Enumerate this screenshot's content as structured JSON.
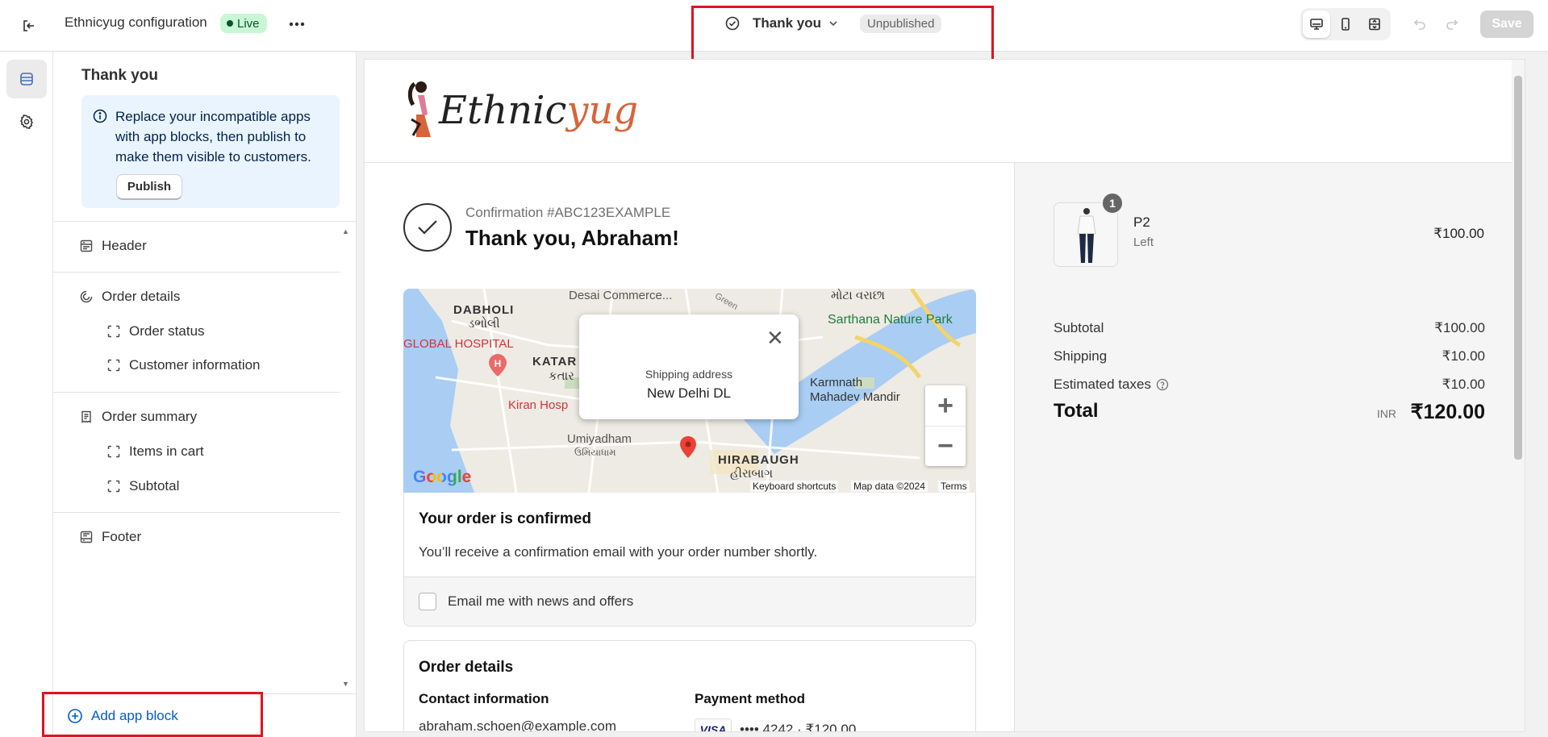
{
  "topbar": {
    "store_title": "Ethnicyug configuration",
    "live_label": "Live",
    "template_name": "Thank you",
    "template_status": "Unpublished",
    "save_label": "Save"
  },
  "sidebar": {
    "title": "Thank you",
    "banner_text": "Replace your incompatible apps with app blocks, then publish to make them visible to customers.",
    "publish_label": "Publish",
    "sections": {
      "header": "Header",
      "order_details": "Order details",
      "order_status": "Order status",
      "customer_information": "Customer information",
      "order_summary": "Order summary",
      "items_in_cart": "Items in cart",
      "subtotal": "Subtotal",
      "footer": "Footer"
    },
    "add_app_block_label": "Add app block"
  },
  "preview": {
    "logo_main": "Ethnic",
    "logo_accent": "yug",
    "confirmation_number": "Confirmation #ABC123EXAMPLE",
    "thank_you": "Thank you, Abraham!",
    "map": {
      "tooltip_label": "Shipping address",
      "tooltip_value": "New Delhi DL",
      "labels": [
        "Desai Commerce...",
        "DABHOLI",
        "ડભોલી",
        "GLOBAL HOSPITAL",
        "KATAR",
        "કતાર",
        "Kiran Hosp",
        "મોટા વરાછા",
        "Sarthana Nature Park",
        "Karmnath",
        "Mahadev Mandir",
        "Umiyadham",
        "ઉમિયાધામ",
        "HIRABAUGH",
        "હીરાબાગ",
        "Green"
      ],
      "google": "Google",
      "attrib_shortcuts": "Keyboard shortcuts",
      "attrib_data": "Map data ©2024",
      "attrib_terms": "Terms"
    },
    "order_confirmed_title": "Your order is confirmed",
    "order_confirmed_text": "You’ll receive a confirmation email with your order number shortly.",
    "email_opt_in": "Email me with news and offers",
    "order_details_title": "Order details",
    "contact_heading": "Contact information",
    "contact_email": "abraham.schoen@example.com",
    "payment_heading": "Payment method",
    "payment_card": "VISA",
    "payment_value": "•••• 4242 · ₹120.00"
  },
  "summary": {
    "quantity": "1",
    "product_name": "P2",
    "product_variant": "Left",
    "product_price": "₹100.00",
    "subtotal_label": "Subtotal",
    "subtotal_value": "₹100.00",
    "shipping_label": "Shipping",
    "shipping_value": "₹10.00",
    "taxes_label": "Estimated taxes",
    "taxes_value": "₹10.00",
    "total_label": "Total",
    "total_currency": "INR",
    "total_value": "₹120.00"
  },
  "colors": {
    "highlight": "#e0131f",
    "live_bg": "#c8f7d6",
    "link_blue": "#005bd3",
    "banner_bg": "#eaf4ff"
  }
}
